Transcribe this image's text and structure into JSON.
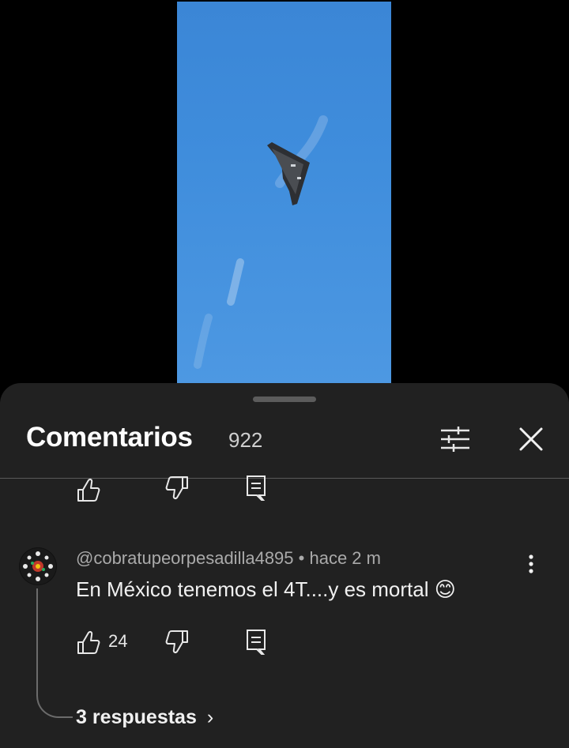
{
  "video": {
    "description_icon": "stealth-bomber-in-sky"
  },
  "comments_panel": {
    "title": "Comentarios",
    "count": "922"
  },
  "comment": {
    "author": "@cobratupeorpesadilla4895",
    "separator": "•",
    "time": "hace 2 m",
    "text": "En México tenemos el 4T....y es mortal 😊",
    "likes": "24",
    "replies_label": "3 respuestas",
    "replies_chevron": "›"
  },
  "colors": {
    "sheet_bg": "#212121",
    "page_bg": "#000000",
    "sky": "#3f8ddc"
  }
}
